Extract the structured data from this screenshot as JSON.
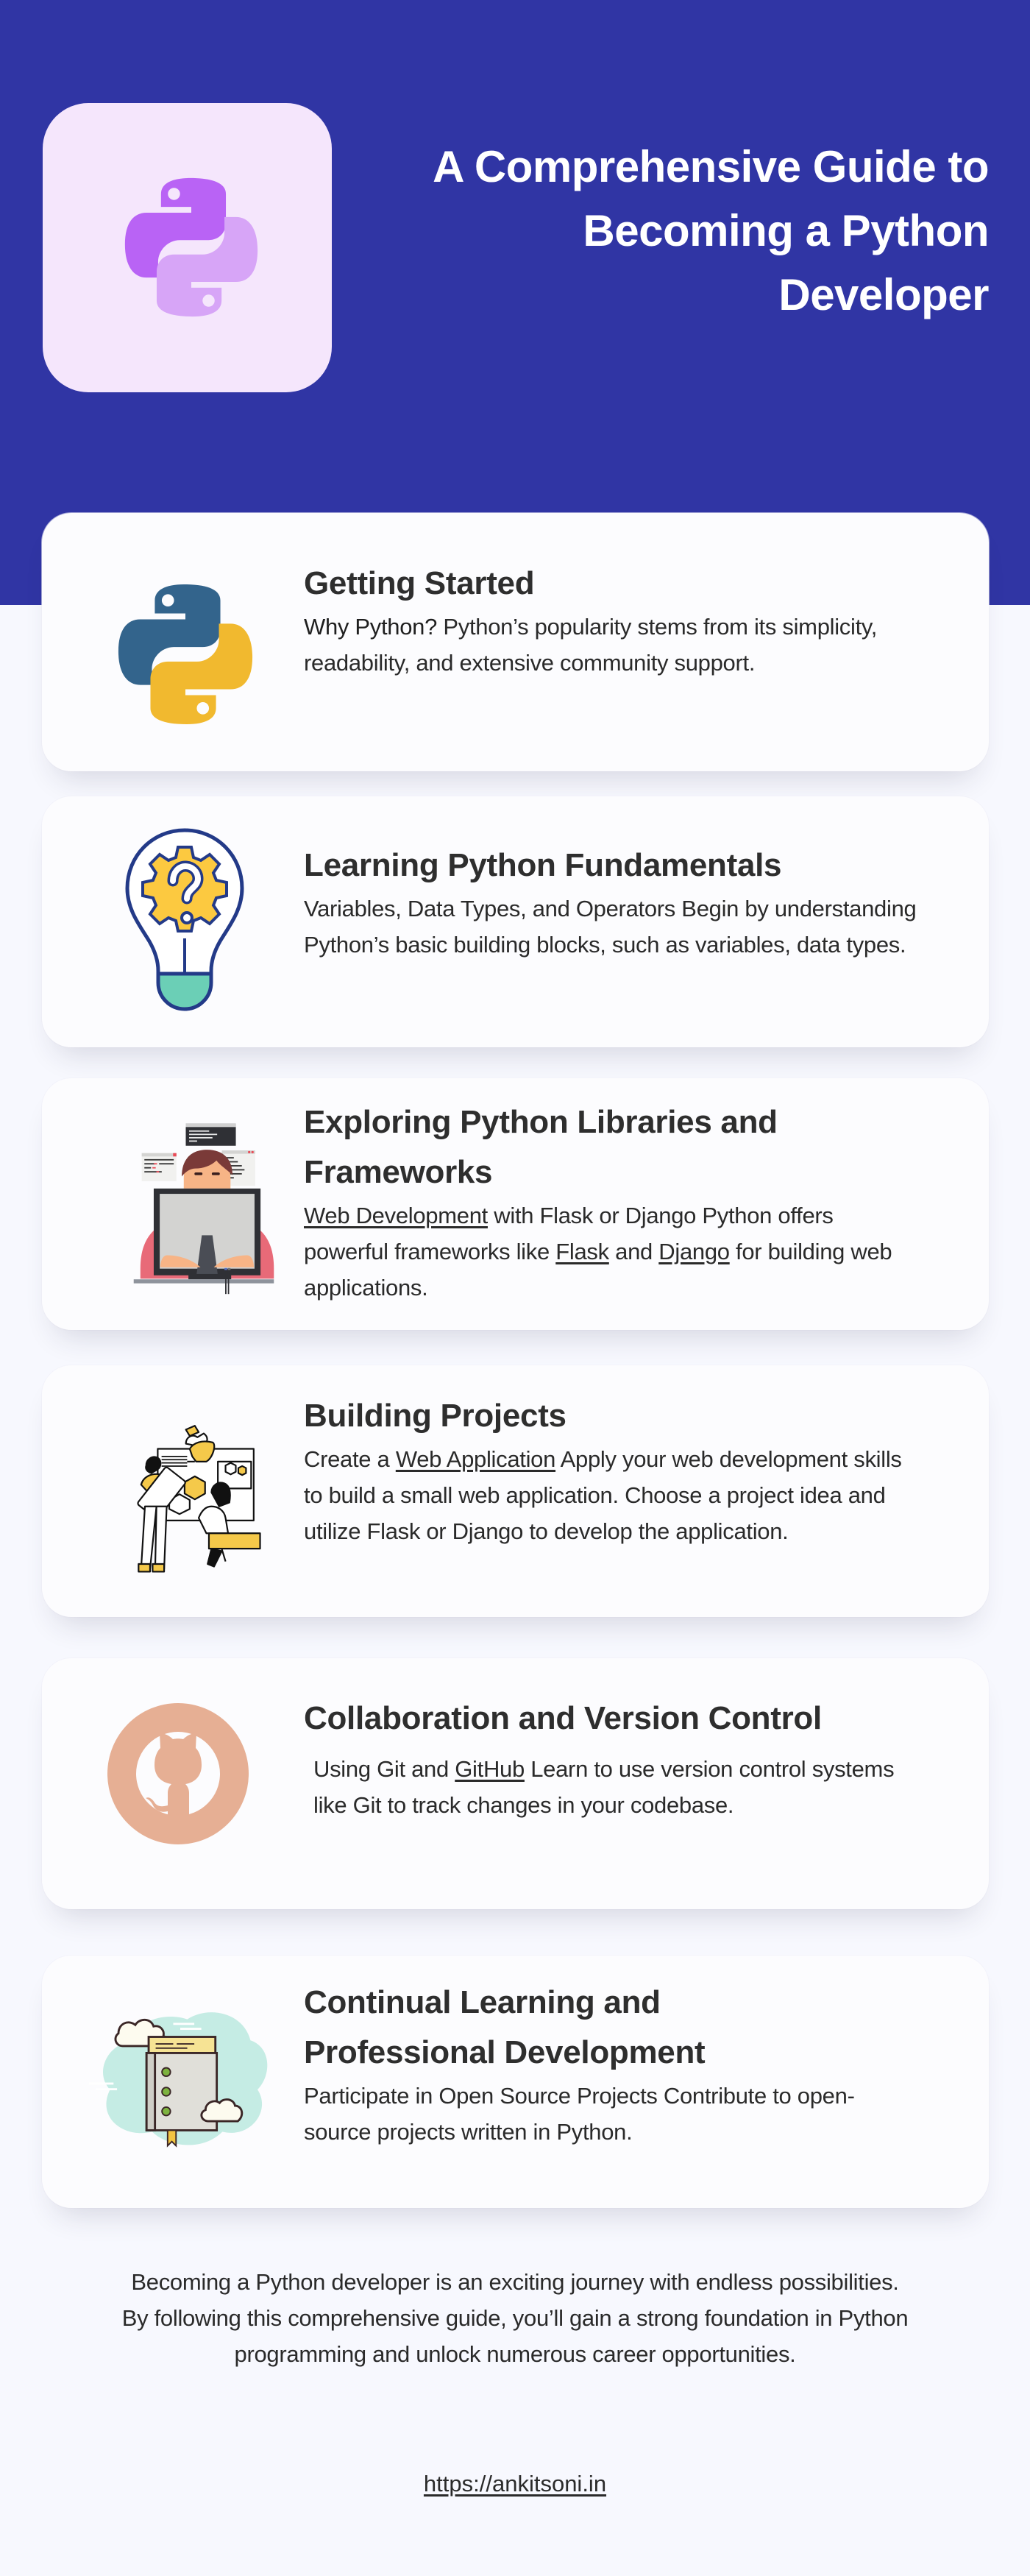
{
  "header": {
    "title": "A Comprehensive Guide to Becoming a Python Developer",
    "logo": "python-logo-icon"
  },
  "colors": {
    "header_bg": "#3035A4",
    "page_bg": "#F7F8FE",
    "card_bg": "#FCFCFE",
    "tile_bg": "#F5E6FC",
    "python_purple": "#B963F5",
    "python_lilac": "#D7A5F7",
    "python_blue": "#33648C",
    "python_yellow": "#F1B92F",
    "github_peach": "#E6AF94",
    "text_dark": "#2E2E2E"
  },
  "sections": [
    {
      "icon": "python-logo-icon",
      "title": "Getting Started",
      "lead": "Why Python?",
      "body": " Python’s popularity stems from its simplicity, readability, and extensive community support."
    },
    {
      "icon": "lightbulb-gear-question-icon",
      "title": "Learning Python Fundamentals",
      "body": "Variables, Data Types, and Operators Begin by understanding Python’s basic building blocks, such as variables, data types."
    },
    {
      "icon": "developer-at-computer-icon",
      "title": "Exploring Python Libraries and Frameworks",
      "link1": "Web Development",
      "body1": " with Flask or Django Python offers powerful frameworks like ",
      "link2": "Flask",
      "body2": " and ",
      "link3": "Django",
      "body3": " for building web applications."
    },
    {
      "icon": "team-building-project-icon",
      "title": "Building Projects",
      "body1": "Create a ",
      "link1": "Web Application",
      "body2": " Apply your web development skills to build a small web application. Choose a project idea and utilize Flask or Django to develop the application."
    },
    {
      "icon": "github-octocat-icon",
      "title": "Collaboration and Version Control",
      "body1": "Using Git and ",
      "link1": "GitHub",
      "body2": " Learn to use version control systems like Git to track changes in your codebase."
    },
    {
      "icon": "book-clouds-icon",
      "title": "Continual Learning and Professional Development",
      "body": "Participate in Open Source Projects Contribute to open-source projects written in Python."
    }
  ],
  "closing": {
    "text": "Becoming a Python developer is an exciting journey with endless possibilities. By following this comprehensive guide, you’ll gain a strong foundation in Python programming and unlock numerous career opportunities.",
    "link": "https://ankitsoni.in"
  }
}
